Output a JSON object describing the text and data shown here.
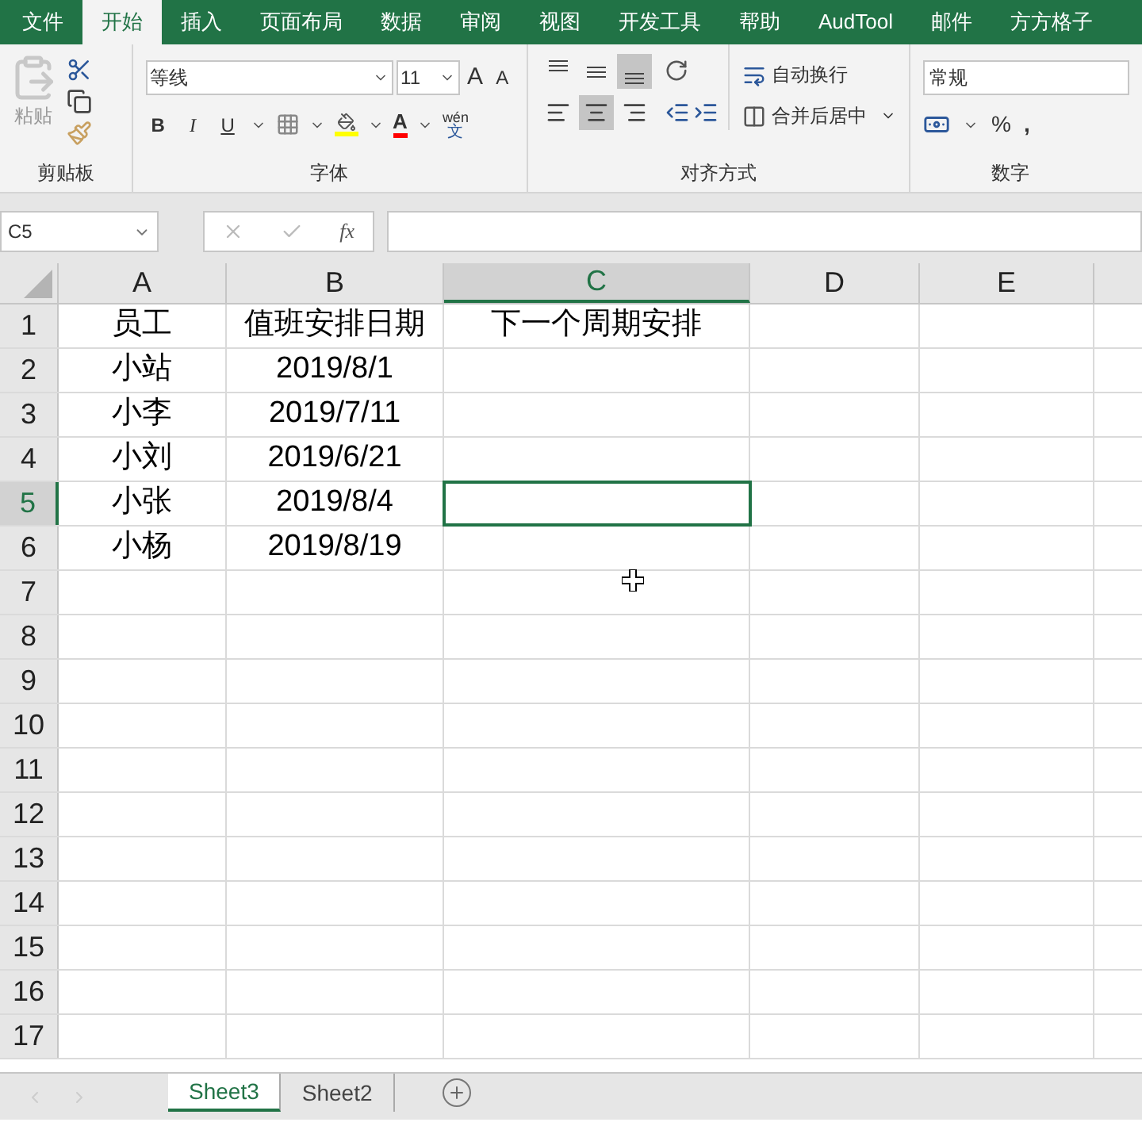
{
  "tabs": [
    {
      "label": "文件",
      "selected": false
    },
    {
      "label": "开始",
      "selected": true
    },
    {
      "label": "插入",
      "selected": false
    },
    {
      "label": "页面布局",
      "selected": false
    },
    {
      "label": "数据",
      "selected": false
    },
    {
      "label": "审阅",
      "selected": false
    },
    {
      "label": "视图",
      "selected": false
    },
    {
      "label": "开发工具",
      "selected": false
    },
    {
      "label": "帮助",
      "selected": false
    },
    {
      "label": "AudTool",
      "selected": false
    },
    {
      "label": "邮件",
      "selected": false
    },
    {
      "label": "方方格子",
      "selected": false
    }
  ],
  "ribbon": {
    "clipboard": {
      "paste": "粘贴",
      "label": "剪贴板"
    },
    "font": {
      "font_name": "等线",
      "font_size": "11",
      "grow": "A",
      "shrink": "A",
      "bold": "B",
      "italic": "I",
      "underline": "U",
      "font_color": "A",
      "phonetic_top": "wén",
      "phonetic_bottom": "文",
      "label": "字体"
    },
    "alignment": {
      "vertical": [
        {
          "kind": "top",
          "selected": false
        },
        {
          "kind": "middle",
          "selected": false
        },
        {
          "kind": "bottom",
          "selected": true
        }
      ],
      "horizontal": [
        {
          "kind": "left",
          "selected": false
        },
        {
          "kind": "center",
          "selected": true
        },
        {
          "kind": "right",
          "selected": false
        }
      ],
      "wrap": "自动换行",
      "merge": "合并后居中",
      "label": "对齐方式"
    },
    "number": {
      "format": "常规",
      "percent": "%",
      "comma": ",",
      "label": "数字"
    }
  },
  "formula_bar": {
    "name_box": "C5",
    "fx": "fx"
  },
  "grid": {
    "columns": [
      {
        "label": "A",
        "selected": false
      },
      {
        "label": "B",
        "selected": false
      },
      {
        "label": "C",
        "selected": true
      },
      {
        "label": "D",
        "selected": false
      },
      {
        "label": "E",
        "selected": false
      }
    ],
    "rows": [
      {
        "label": "1",
        "selected": false,
        "cells": [
          "员工",
          "值班安排日期",
          "下一个周期安排"
        ]
      },
      {
        "label": "2",
        "selected": false,
        "cells": [
          "小站",
          "2019/8/1"
        ]
      },
      {
        "label": "3",
        "selected": false,
        "cells": [
          "小李",
          "2019/7/11"
        ]
      },
      {
        "label": "4",
        "selected": false,
        "cells": [
          "小刘",
          "2019/6/21"
        ]
      },
      {
        "label": "5",
        "selected": true,
        "cells": [
          "小张",
          "2019/8/4"
        ]
      },
      {
        "label": "6",
        "selected": false,
        "cells": [
          "小杨",
          "2019/8/19"
        ]
      },
      {
        "label": "7",
        "selected": false
      },
      {
        "label": "8",
        "selected": false
      },
      {
        "label": "9",
        "selected": false
      },
      {
        "label": "10",
        "selected": false
      },
      {
        "label": "11",
        "selected": false
      },
      {
        "label": "12",
        "selected": false
      },
      {
        "label": "13",
        "selected": false
      },
      {
        "label": "14",
        "selected": false
      },
      {
        "label": "15",
        "selected": false
      },
      {
        "label": "16",
        "selected": false
      },
      {
        "label": "17",
        "selected": false
      }
    ]
  },
  "sheets": [
    {
      "label": "Sheet3",
      "selected": true
    },
    {
      "label": "Sheet2",
      "selected": false
    }
  ]
}
